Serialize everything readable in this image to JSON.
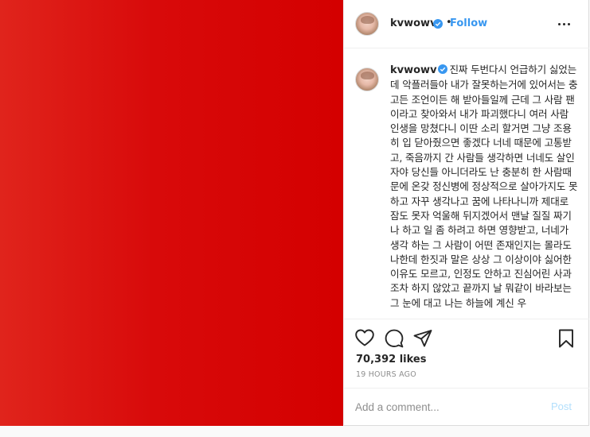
{
  "post": {
    "media": {
      "background": "#d80a0a"
    },
    "header": {
      "username": "kvwowv",
      "verified": true,
      "separator": "•",
      "follow_label": "Follow",
      "more_icon": "more-horizontal-icon"
    },
    "caption": {
      "username": "kvwowv",
      "text": "진짜 두번다시 언급하기 싫었는데 악플러들아 내가 잘못하는거에 있어서는 충고든 조언이든 해 받아들일께 근데 그 사람 팬이라고 찾아와서 내가 파괴했다니 여러 사람 인생을 망쳤다니 이딴 소리 할거면 그냥 조용히 입 닫아줬으면 좋겠다 너네 때문에 고통받고, 죽음까지 간 사람들 생각하면 너네도 살인자야 당신들 아니더라도 난 충분히 한 사람때문에 온갖 정신병에 정상적으로 살아가지도 못하고 자꾸 생각나고 꿈에 나타나니까 제대로 잠도 못자 억울해 뒤지겠어서 맨날 질질 짜기나 하고 일 좀 하려고 하면 영향받고, 너네가 생각 하는 그 사람이 어떤 존재인지는 몰라도 나한데 한짓과 말은 상상 그 이상이야 싫어한 이유도 모르고, 인정도 안하고 진심어린 사과조차 하지 않았고 끝까지 날 뭐같이 바라보는 그 눈에 대고 나는 하늘에 계신 우"
    },
    "actions": {
      "like_icon": "heart-icon",
      "comment_icon": "comment-bubble-icon",
      "share_icon": "paper-plane-icon",
      "save_icon": "bookmark-icon"
    },
    "likes": "70,392 likes",
    "timestamp": "19 HOURS AGO",
    "comment_box": {
      "placeholder": "Add a comment...",
      "post_label": "Post"
    }
  },
  "colors": {
    "accent": "#3897f0",
    "text": "#262626",
    "muted": "#8e8e8e",
    "post_disabled": "#b2dffc"
  }
}
